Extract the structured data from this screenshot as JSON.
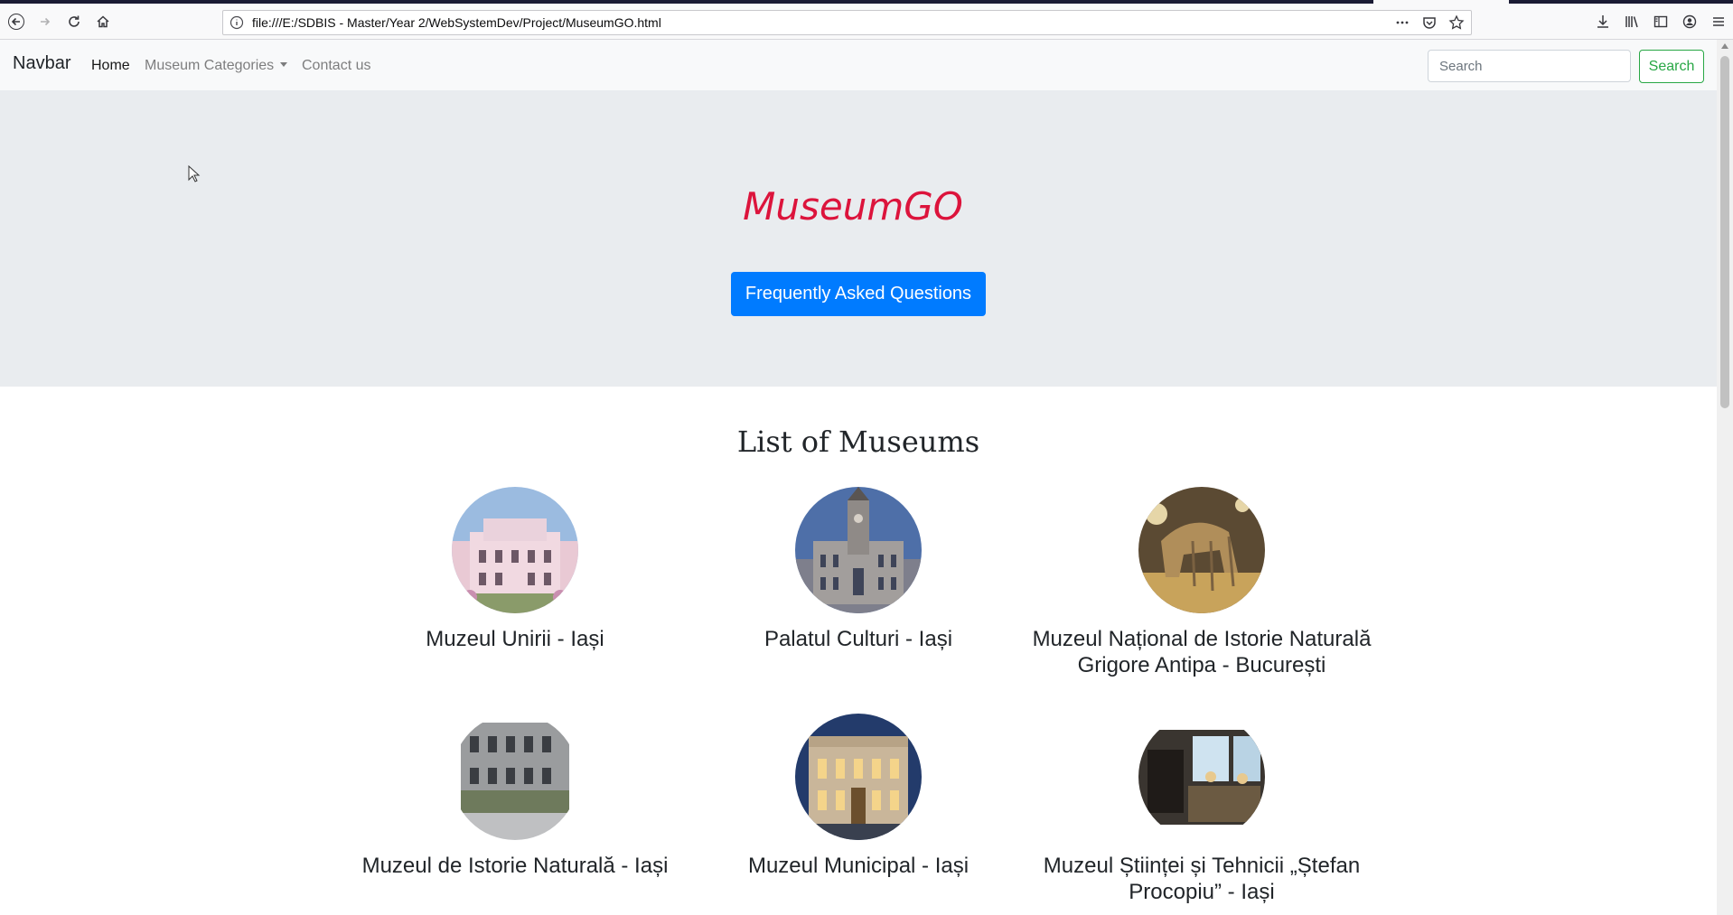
{
  "browser": {
    "url": "file:///E:/SDBIS - Master/Year 2/WebSystemDev/Project/MuseumGO.html"
  },
  "navbar": {
    "brand": "Navbar",
    "links": [
      {
        "label": "Home",
        "active": true
      },
      {
        "label": "Museum Categories",
        "dropdown": true
      },
      {
        "label": "Contact us"
      }
    ],
    "search_placeholder": "Search",
    "search_button": "Search"
  },
  "hero": {
    "title": "MuseumGO",
    "faq_button": "Frequently Asked Questions"
  },
  "list": {
    "title": "List of Museums",
    "museums": [
      {
        "name": "Muzeul Unirii - Iași"
      },
      {
        "name": "Palatul Culturi - Iași"
      },
      {
        "name": "Muzeul Național de Istorie Naturală Grigore Antipa - București"
      },
      {
        "name": "Muzeul de Istorie Naturală - Iași"
      },
      {
        "name": "Muzeul Municipal - Iași"
      },
      {
        "name": "Muzeul Științei și Tehnicii „Ștefan Procopiu” - Iași"
      }
    ]
  },
  "colors": {
    "title": "#dc143c",
    "primary": "#007bff",
    "success": "#28a745",
    "jumbotron": "#e9ecef"
  }
}
